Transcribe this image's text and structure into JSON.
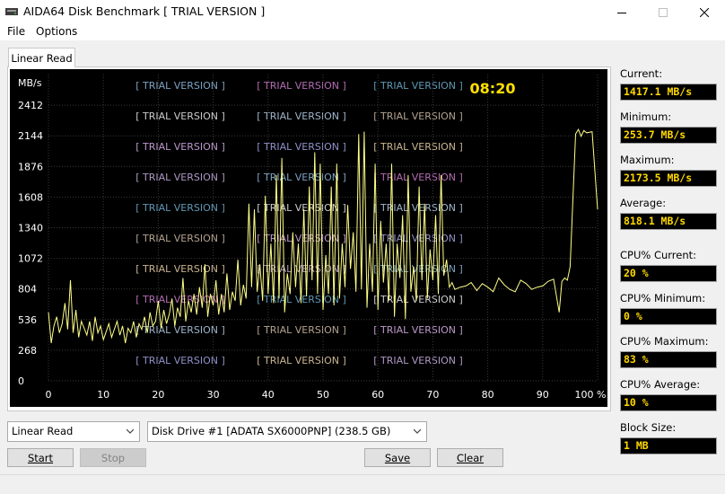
{
  "window": {
    "title": "AIDA64 Disk Benchmark  [ TRIAL VERSION ]"
  },
  "menu": {
    "file": "File",
    "options": "Options"
  },
  "tab": {
    "label": "Linear Read"
  },
  "chart_data": {
    "type": "line",
    "title": "",
    "unit_label": "MB/s",
    "timer": "08:20",
    "xlabel": "",
    "ylabel": "MB/s",
    "x_ticks": [
      "0",
      "10",
      "20",
      "30",
      "40",
      "50",
      "60",
      "70",
      "80",
      "90",
      "100 %"
    ],
    "y_ticks": [
      "0",
      "268",
      "536",
      "804",
      "1072",
      "1340",
      "1608",
      "1876",
      "2144",
      "2412"
    ],
    "xlim": [
      0,
      100
    ],
    "ylim": [
      0,
      2680
    ],
    "grid": true,
    "watermark_text": "[ TRIAL VERSION ]",
    "line_color": "#ffff88",
    "series": [
      {
        "x": [
          0,
          0.5,
          1,
          1.5,
          2,
          2.5,
          3,
          3.5,
          4,
          4.5,
          5,
          5.5,
          6,
          6.5,
          7,
          7.5,
          8,
          8.5,
          9,
          9.5,
          10,
          10.5,
          11,
          11.5,
          12,
          12.5,
          13,
          13.5,
          14,
          14.5,
          15,
          15.5,
          16,
          16.5,
          17,
          17.5,
          18,
          18.5,
          19,
          19.5,
          20,
          20.5,
          21,
          21.5,
          22,
          22.5,
          23,
          23.5,
          24,
          24.5,
          25,
          25.5,
          26,
          26.5,
          27,
          27.5,
          28,
          28.5,
          29,
          29.5,
          30,
          30.5,
          31,
          31.5,
          32,
          32.5,
          33,
          33.5,
          34,
          34.5,
          35,
          35.5,
          36,
          36.5,
          37,
          37.5,
          38,
          38.5,
          39,
          39.5,
          40,
          40.5,
          41,
          41.5,
          42,
          42.5,
          43,
          43.5,
          44,
          44.5,
          45,
          45.5,
          46,
          46.5,
          47,
          47.5,
          48,
          48.5,
          49,
          49.5,
          50,
          50.5,
          51,
          51.5,
          52,
          52.5,
          53,
          53.5,
          54,
          54.5,
          55,
          55.5,
          56,
          56.5,
          57,
          57.5,
          58,
          58.5,
          59,
          59.5,
          60,
          60.5,
          61,
          61.5,
          62,
          62.5,
          63,
          63.5,
          64,
          64.5,
          65,
          65.5,
          66,
          66.5,
          67,
          67.5,
          68,
          68.5,
          69,
          69.5,
          70,
          70.5,
          71,
          71.5,
          72,
          72.5,
          73,
          73.5,
          74,
          75,
          76,
          77,
          78,
          79,
          80,
          81,
          82,
          83,
          84,
          85,
          86,
          87,
          88,
          89,
          90,
          91,
          92,
          93,
          93.5,
          94,
          94.5,
          95,
          96,
          96.5,
          97,
          97.5,
          98,
          99,
          100
        ],
        "y": [
          600,
          330,
          480,
          560,
          420,
          500,
          680,
          450,
          880,
          420,
          620,
          380,
          520,
          460,
          400,
          520,
          350,
          560,
          420,
          480,
          360,
          430,
          500,
          380,
          450,
          520,
          400,
          480,
          330,
          460,
          420,
          520,
          380,
          500,
          450,
          560,
          420,
          600,
          480,
          520,
          700,
          460,
          620,
          500,
          580,
          720,
          480,
          640,
          560,
          900,
          520,
          700,
          600,
          760,
          580,
          820,
          640,
          1020,
          560,
          760,
          660,
          880,
          580,
          760,
          600,
          940,
          620,
          780,
          700,
          1060,
          660,
          840,
          720,
          1550,
          820,
          1500,
          780,
          1020,
          700,
          1620,
          760,
          1200,
          680,
          1800,
          720,
          1950,
          600,
          940,
          760,
          1300,
          820,
          1200,
          680,
          1500,
          740,
          1700,
          880,
          2000,
          760,
          1900,
          620,
          1100,
          760,
          1700,
          660,
          1900,
          720,
          1200,
          820,
          1540,
          980,
          1300,
          780,
          2160,
          800,
          2180,
          640,
          1200,
          780,
          1900,
          620,
          1400,
          860,
          1200,
          700,
          1900,
          560,
          1200,
          900,
          1450,
          540,
          1800,
          780,
          1000,
          700,
          1700,
          880,
          1550,
          720,
          1150,
          880,
          1450,
          760,
          1800,
          920,
          1060,
          820,
          860,
          800,
          820,
          830,
          860,
          790,
          850,
          820,
          780,
          900,
          840,
          800,
          780,
          880,
          850,
          800,
          820,
          830,
          870,
          890,
          600,
          870,
          900,
          880,
          1000,
          2160,
          2200,
          2140,
          2190,
          2170,
          2180,
          1500
        ]
      }
    ]
  },
  "stats": {
    "current_label": "Current:",
    "current_value": "1417.1 MB/s",
    "minimum_label": "Minimum:",
    "minimum_value": "253.7 MB/s",
    "maximum_label": "Maximum:",
    "maximum_value": "2173.5 MB/s",
    "average_label": "Average:",
    "average_value": "818.1 MB/s",
    "cpu_current_label": "CPU% Current:",
    "cpu_current_value": "20 %",
    "cpu_minimum_label": "CPU% Minimum:",
    "cpu_minimum_value": "0 %",
    "cpu_maximum_label": "CPU% Maximum:",
    "cpu_maximum_value": "83 %",
    "cpu_average_label": "CPU% Average:",
    "cpu_average_value": "10 %",
    "block_size_label": "Block Size:",
    "block_size_value": "1 MB"
  },
  "controls": {
    "test_select": "Linear Read",
    "drive_select": "Disk Drive #1  [ADATA SX6000PNP]  (238.5 GB)",
    "start_label": "Start",
    "stop_label": "Stop",
    "save_label": "Save",
    "clear_label": "Clear"
  }
}
